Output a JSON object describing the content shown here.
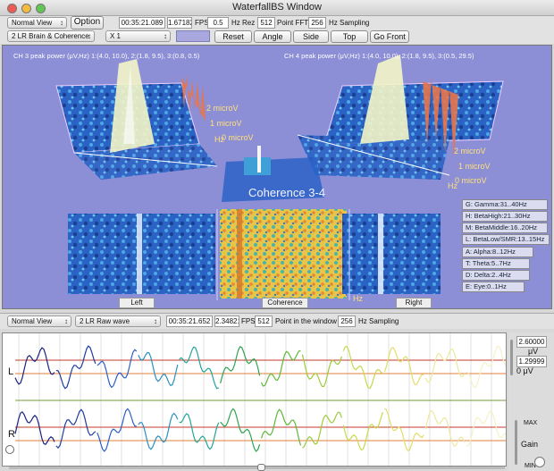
{
  "window": {
    "title": "WaterfallBS Window"
  },
  "toolbar1": {
    "view_mode": "Normal View",
    "option_label": "Option",
    "elapsed": "00:35:21.089",
    "fps_value": "1.67182",
    "fps_label": "FPS",
    "hz_rez_value": "0.5",
    "hz_rez_label": "Hz Rez",
    "fft_value": "512",
    "fft_label": "Point FFT",
    "sampling_value": "256",
    "sampling_label": "Hz Sampling"
  },
  "toolbar2": {
    "montage": "2 LR Brain & Coherence",
    "scale": "X 1",
    "reset_label": "Reset",
    "angle_label": "Angle",
    "side_label": "Side",
    "top_label": "Top",
    "go_front_label": "Go Front"
  },
  "scene": {
    "ch3_peak": "CH 3 peak power (μV,Hz) 1:(4.0, 10.0), 2:(1.8, 9.5), 3:(0.8, 0.5)",
    "ch4_peak": "CH 4 peak power (μV,Hz) 1:(4.0, 10.0), 2:(1.8, 9.5), 3:(0.5, 29.5)",
    "coherence_label": "Coherence 3-4",
    "left_axis": [
      "2 microV",
      "1 microV",
      "0 microV",
      "Hz"
    ],
    "right_axis": [
      "2 microV",
      "1 microV",
      "0 microV",
      "Hz"
    ],
    "left_label": "Left",
    "coherence_panel_label": "Coherence",
    "right_label": "Right",
    "hz_label": "Hz",
    "bands": [
      "G: Gamma:31..40Hz",
      "H: BetaHigh:21..30Hz",
      "M: BetaMiddle:16..20Hz",
      "L: BetaLow/SMR:13..15Hz",
      "A: Alpha:8..12Hz",
      "T: Theta:5..7Hz",
      "D: Delta:2..4Hz",
      "E: Eye:0..1Hz"
    ]
  },
  "toolbar3": {
    "view_mode": "Normal View",
    "montage": "2 LR Raw wave",
    "elapsed": "00:35:21.652",
    "fps_value": "2.34821",
    "fps_label": "FPS",
    "points_value": "512",
    "points_label": "Point in the window",
    "sampling_value": "256",
    "sampling_label": "Hz Sampling"
  },
  "wave": {
    "channel_l": "L",
    "channel_r": "R",
    "scale_top": "2.60000",
    "scale_unit_top": "μV",
    "scale_bottom": "1.29999",
    "scale_unit_bottom": "0 μV",
    "max_label": "MAX",
    "gain_label": "Gain",
    "min_label": "MIN"
  },
  "colors": {
    "scene_bg": "#8c8ed6",
    "accent_red": "#c0392b",
    "accent_green": "#9ccc3c"
  }
}
